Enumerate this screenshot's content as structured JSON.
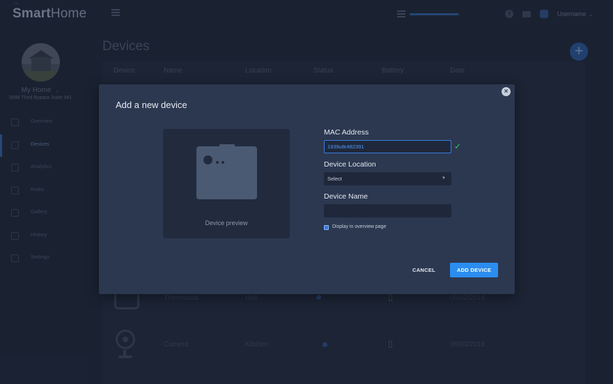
{
  "app": {
    "logo": {
      "prefix": "Smart",
      "suffix": "Home"
    },
    "username": "Username",
    "progress_fraction": 0.97,
    "colors": {
      "accent": "#2a8df0",
      "success": "#35c46b",
      "modal_bg": "#2c3850"
    }
  },
  "sidebar": {
    "home_name": "My Home",
    "home_address": "5898 Third Bypass Suite 541",
    "items": [
      {
        "label": "Overview",
        "icon": "overview-icon"
      },
      {
        "label": "Devices",
        "icon": "devices-icon"
      },
      {
        "label": "Analytics",
        "icon": "analytics-icon"
      },
      {
        "label": "Rules",
        "icon": "rules-icon"
      },
      {
        "label": "Gallery",
        "icon": "gallery-icon"
      },
      {
        "label": "History",
        "icon": "history-icon"
      },
      {
        "label": "Settings",
        "icon": "settings-icon"
      }
    ],
    "active_item": "Devices"
  },
  "main": {
    "title": "Devices",
    "table": {
      "headers": [
        "Device",
        "Name",
        "Location",
        "Status",
        "Battery",
        "Date"
      ],
      "rows": [
        {
          "name": "Thermostat",
          "location": "Hall",
          "date": "06/02/2018"
        },
        {
          "name": "Camera",
          "location": "Kitchen",
          "date": "06/03/2018"
        }
      ]
    }
  },
  "modal": {
    "title": "Add a new device",
    "preview_label": "Device preview",
    "mac": {
      "label": "MAC Address",
      "value": "1939u8r482391"
    },
    "location": {
      "label": "Device Location",
      "value": "Select"
    },
    "name": {
      "label": "Device Name",
      "value": ""
    },
    "overview_checkbox": {
      "label": "Display in overview page",
      "checked": true
    },
    "cancel_label": "CANCEL",
    "add_label": "ADD DEVICE"
  }
}
